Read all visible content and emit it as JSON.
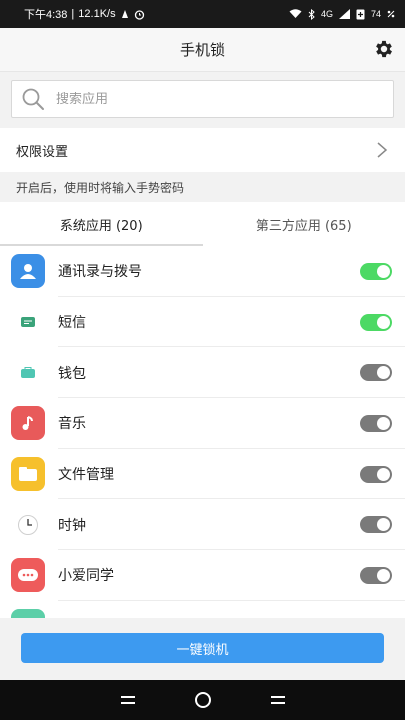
{
  "status_bar": {
    "time": "下午4:38",
    "separator": "|",
    "speed": "12.1K/s",
    "network": "4G",
    "battery": "74"
  },
  "header": {
    "title": "手机锁"
  },
  "search": {
    "placeholder": "搜索应用"
  },
  "permissions": {
    "label": "权限设置"
  },
  "hint": "开启后，使用时将输入手势密码",
  "tabs": [
    {
      "label": "系统应用 (20)",
      "active": true
    },
    {
      "label": "第三方应用 (65)",
      "active": false
    }
  ],
  "apps": [
    {
      "name": "通讯录与拨号",
      "icon": "contacts-icon",
      "enabled": true
    },
    {
      "name": "短信",
      "icon": "sms-icon",
      "enabled": true
    },
    {
      "name": "钱包",
      "icon": "wallet-icon",
      "enabled": false
    },
    {
      "name": "音乐",
      "icon": "music-icon",
      "enabled": false
    },
    {
      "name": "文件管理",
      "icon": "file-manager-icon",
      "enabled": false
    },
    {
      "name": "时钟",
      "icon": "clock-icon",
      "enabled": false
    },
    {
      "name": "小爱同学",
      "icon": "xiaoai-icon",
      "enabled": false
    }
  ],
  "actions": {
    "lock_all": "一键锁机"
  },
  "colors": {
    "accent": "#3d9af0",
    "toggle_on": "#4cd964",
    "toggle_off": "#7a7a7a"
  }
}
